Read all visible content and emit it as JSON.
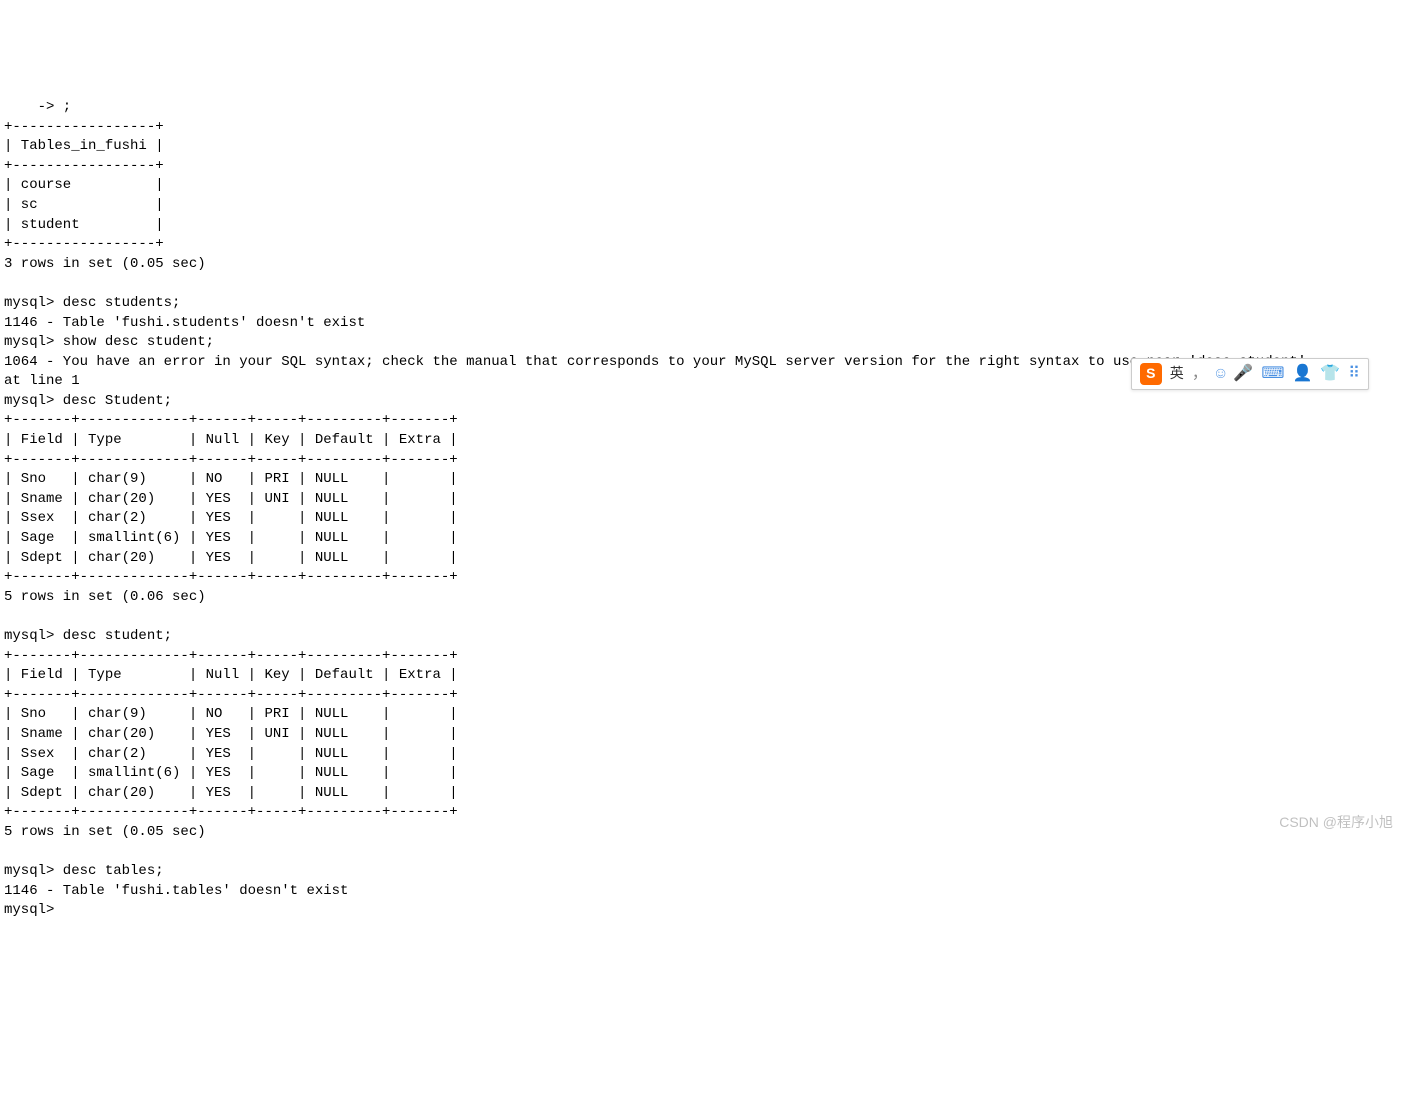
{
  "terminal": {
    "line_arrow": "    -> ;",
    "tables_header": "+-----------------+\n| Tables_in_fushi |\n+-----------------+",
    "tables_rows": "| course          |\n| sc              |\n| student         |",
    "tables_footer": "+-----------------+",
    "tables_result": "3 rows in set (0.05 sec)",
    "prompt1": "mysql> desc students;",
    "error1": "1146 - Table 'fushi.students' doesn't exist",
    "prompt2": "mysql> show desc student;",
    "error2": "1064 - You have an error in your SQL syntax; check the manual that corresponds to your MySQL server version for the right syntax to use near 'desc student'\nat line 1",
    "prompt3": "mysql> desc Student;",
    "desc_separator": "+-------+-------------+------+-----+---------+-------+",
    "desc_header": "| Field | Type        | Null | Key | Default | Extra |",
    "desc_rows_1": "| Sno   | char(9)     | NO   | PRI | NULL    |       |\n| Sname | char(20)    | YES  | UNI | NULL    |       |\n| Ssex  | char(2)     | YES  |     | NULL    |       |\n| Sage  | smallint(6) | YES  |     | NULL    |       |\n| Sdept | char(20)    | YES  |     | NULL    |       |",
    "desc_result1": "5 rows in set (0.06 sec)",
    "prompt4": "mysql> desc student;",
    "desc_rows_2": "| Sno   | char(9)     | NO   | PRI | NULL    |       |\n| Sname | char(20)    | YES  | UNI | NULL    |       |\n| Ssex  | char(2)     | YES  |     | NULL    |       |\n| Sage  | smallint(6) | YES  |     | NULL    |       |\n| Sdept | char(20)    | YES  |     | NULL    |       |",
    "desc_result2": "5 rows in set (0.05 sec)",
    "prompt5": "mysql> desc tables;",
    "error3": "1146 - Table 'fushi.tables' doesn't exist",
    "prompt6": "mysql>"
  },
  "ime": {
    "logo": "S",
    "lang": "英",
    "comma": "，",
    "smile": "☺",
    "mic": "🎤",
    "keyboard": "⌨",
    "user": "👤",
    "shirt": "👕",
    "grid": "⠿"
  },
  "watermark": "CSDN @程序小旭"
}
